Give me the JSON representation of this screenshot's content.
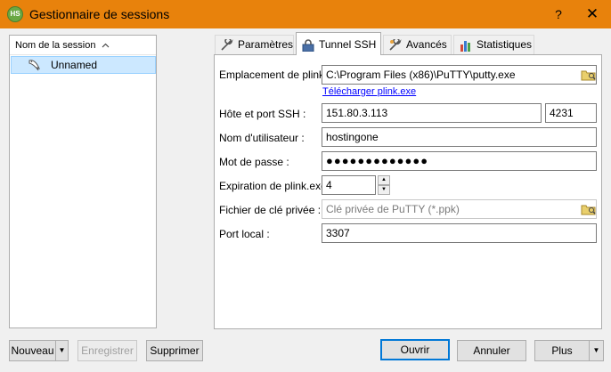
{
  "window": {
    "app_icon_text": "HS",
    "title": "Gestionnaire de sessions",
    "help_label": "?",
    "close_label": "✕"
  },
  "sessions": {
    "column_header": "Nom de la session",
    "items": [
      {
        "label": "Unnamed",
        "icon": "dolphin-icon",
        "selected": true
      }
    ]
  },
  "tabs": [
    {
      "label": "Paramètres",
      "icon": "wrench-icon"
    },
    {
      "label": "Tunnel SSH",
      "icon": "lock-icon",
      "active": true
    },
    {
      "label": "Avancés",
      "icon": "wrench-icon"
    },
    {
      "label": "Statistiques",
      "icon": "bar-chart-icon"
    }
  ],
  "form": {
    "plink_label": "Emplacement de plink",
    "plink_value": "C:\\Program Files (x86)\\PuTTY\\putty.exe",
    "download_link": "Télécharger plink.exe",
    "host_label": "Hôte et port SSH :",
    "host_value": "151.80.3.113",
    "port_value": "4231",
    "user_label": "Nom d'utilisateur :",
    "user_value": "hostingone",
    "password_label": "Mot de passe :",
    "password_value": "●●●●●●●●●●●●●",
    "timeout_label": "Expiration de plink.exe",
    "timeout_value": "4",
    "keyfile_label": "Fichier de clé privée :",
    "keyfile_placeholder": "Clé privée de PuTTY (*.ppk)",
    "localport_label": "Port local :",
    "localport_value": "3307"
  },
  "buttons": {
    "new": "Nouveau",
    "save": "Enregistrer",
    "delete": "Supprimer",
    "open": "Ouvrir",
    "cancel": "Annuler",
    "more": "Plus"
  },
  "colors": {
    "titlebar": "#e8820c",
    "selection": "#cce8ff",
    "link": "#0000ff",
    "default_button_border": "#0078d7"
  }
}
